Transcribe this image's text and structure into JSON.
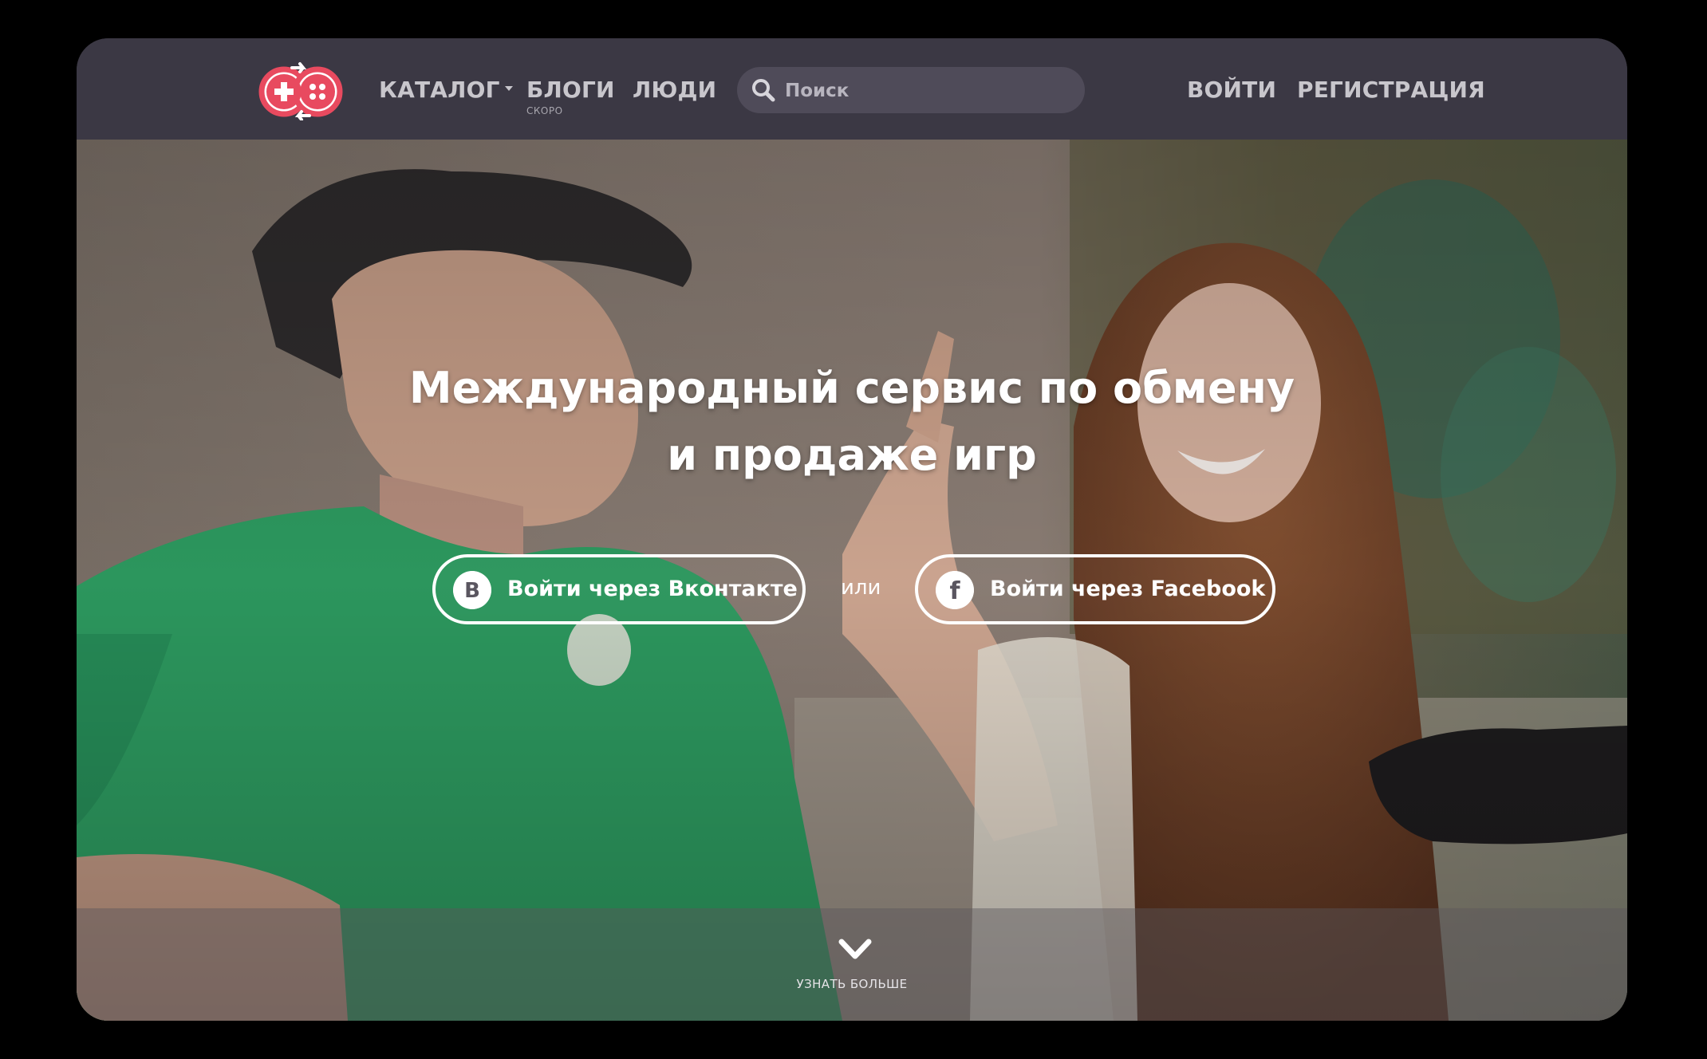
{
  "nav": {
    "catalog": "КАТАЛОГ",
    "blogs": "БЛОГИ",
    "blogs_badge": "СКОРО",
    "people": "ЛЮДИ",
    "login": "ВОЙТИ",
    "register": "РЕГИСТРАЦИЯ"
  },
  "search": {
    "placeholder": "Поиск",
    "value": ""
  },
  "hero": {
    "title_line1": "Международный сервис по обмену",
    "title_line2": "и продаже игр",
    "vk_button": "Войти через Вконтакте",
    "vk_icon_letter": "В",
    "or": "или",
    "fb_button": "Войти через Facebook",
    "fb_icon_letter": "f",
    "learn_more": "УЗНАТЬ БОЛЬШЕ"
  },
  "icons": {
    "logo": "gamepad-exchange-logo-icon",
    "search": "search-icon",
    "vk": "vk-icon",
    "facebook": "facebook-icon",
    "scroll": "chevron-down-icon"
  },
  "colors": {
    "navbar": "#3b3844",
    "brand": "#e84a5f",
    "search_bg": "#4f4b59",
    "nav_text": "#c8c6cc",
    "shirt_green": "#2e9e62"
  }
}
